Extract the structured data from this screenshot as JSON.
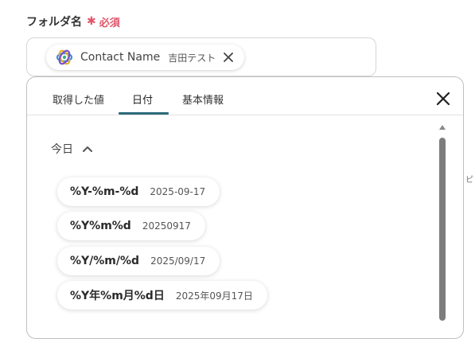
{
  "field_label": "フォルダ名",
  "required_star": "✱",
  "required_text": "必須",
  "chip": {
    "name": "Contact Name",
    "sub": "吉田テスト",
    "icon": "app-logo-icon"
  },
  "tabs": [
    {
      "label": "取得した値",
      "active": false
    },
    {
      "label": "日付",
      "active": true
    },
    {
      "label": "基本情報",
      "active": false
    }
  ],
  "section": {
    "label": "今日",
    "icon": "chevron-up-icon"
  },
  "options": [
    {
      "format": "%Y-%m-%d",
      "example": "2025-09-17"
    },
    {
      "format": "%Y%m%d",
      "example": "20250917"
    },
    {
      "format": "%Y/%m/%d",
      "example": "2025/09/17"
    },
    {
      "format": "%Y年%m月%d日",
      "example": "2025年09月17日"
    }
  ],
  "edge_text": "ピ",
  "colors": {
    "required": "#e0556a",
    "tab_underline": "#2d6b7a",
    "scrollbar": "#7d7d7d"
  }
}
